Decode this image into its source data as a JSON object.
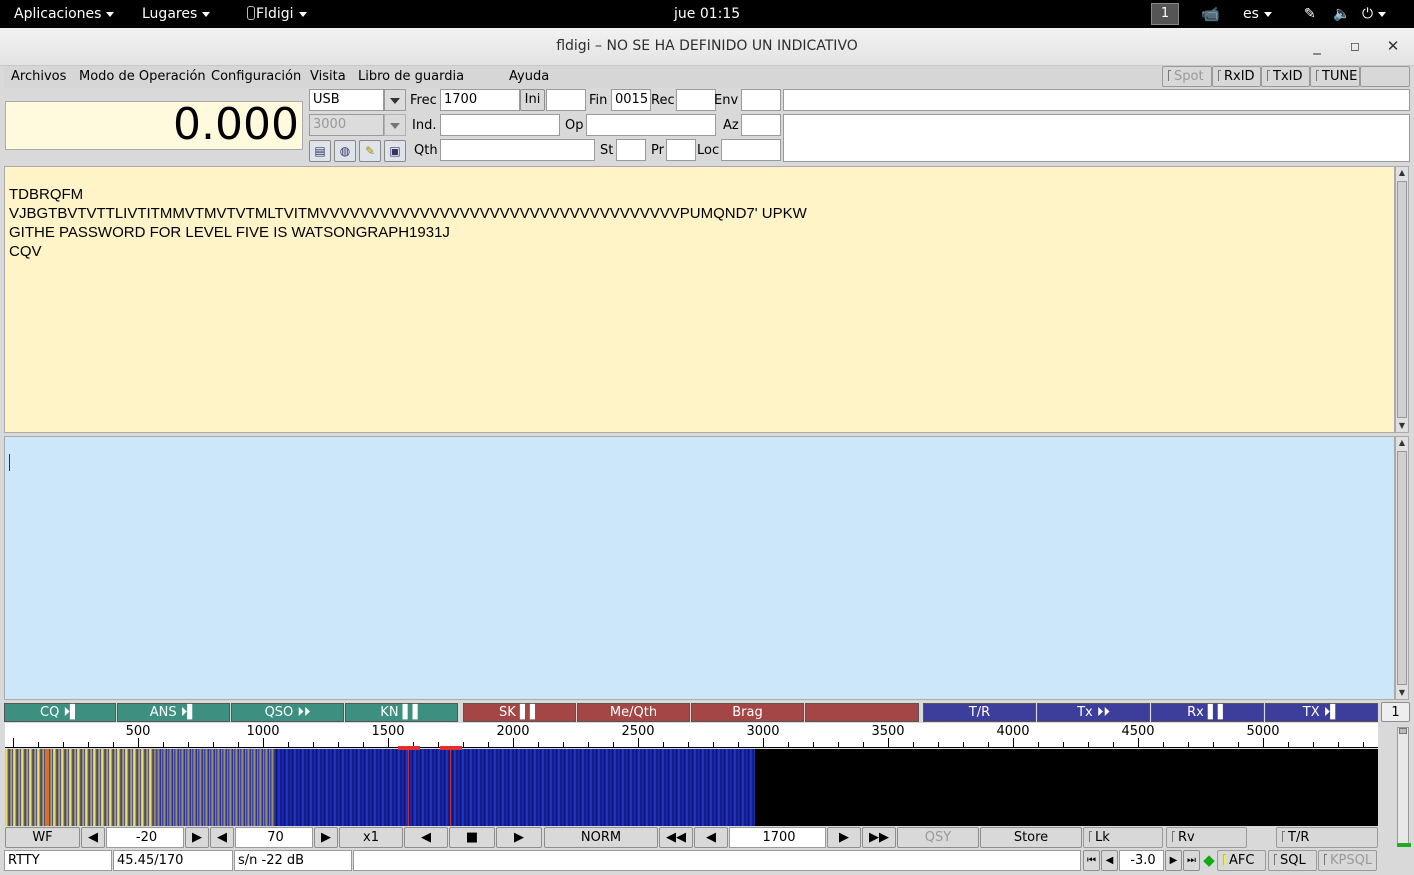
{
  "topbar": {
    "apps": "Aplicaciones",
    "places": "Lugares",
    "app_name": "Fldigi",
    "clock": "jue 01:15",
    "workspace": "1",
    "lang": "es"
  },
  "window": {
    "title": "fldigi – NO SE HA DEFINIDO UN INDICATIVO"
  },
  "menu": {
    "items": [
      "Archivos",
      "Modo de Operación",
      "Configuración",
      "Visita",
      "Libro de guardia",
      "Ayuda"
    ],
    "spot": "Spot",
    "rxid": "RxID",
    "txid": "TxID",
    "tune": "TUNE"
  },
  "log": {
    "frequency": "0.000",
    "mode": "USB",
    "bandwidth": "3000",
    "frec_label": "Frec",
    "frec_value": "1700",
    "ini_label": "Ini",
    "ini_value": "",
    "fin_label": "Fin",
    "fin_value": "0015",
    "rec_label": "Rec",
    "rec_value": "",
    "env_label": "Env",
    "env_value": "",
    "ind_label": "Ind.",
    "ind_value": "",
    "op_label": "Op",
    "op_value": "",
    "az_label": "Az",
    "az_value": "",
    "qth_label": "Qth",
    "qth_value": "",
    "st_label": "St",
    "st_value": "",
    "pr_label": "Pr",
    "pr_value": "",
    "loc_label": "Loc",
    "loc_value": ""
  },
  "rx_text": "TDBRQFM\nVJBGTBVTVTTLIVTITMMVTMVTVTMLTVITMVVVVVVVVVVVVVVVVVVVVVVVVVVVVVVVVVVVVPUMQND7' UPKW\nGITHE PASSWORD FOR LEVEL FIVE IS WATSONGRAPH1931J\nCQV",
  "macros": {
    "buttons": [
      {
        "label": "CQ ⏵▌",
        "color": "green"
      },
      {
        "label": "ANS ⏵▌",
        "color": "green"
      },
      {
        "label": "QSO ⏵⏵",
        "color": "green"
      },
      {
        "label": "KN ▌▌",
        "color": "green"
      },
      {
        "label": "SK ▌▌",
        "color": "red"
      },
      {
        "label": "Me/Qth",
        "color": "red"
      },
      {
        "label": "Brag",
        "color": "red"
      },
      {
        "label": "",
        "color": "red"
      },
      {
        "label": "T/R",
        "color": "blue"
      },
      {
        "label": "Tx ⏵⏵",
        "color": "blue"
      },
      {
        "label": "Rx ▌▌",
        "color": "blue"
      },
      {
        "label": "TX ⏵▌",
        "color": "blue"
      }
    ],
    "page": "1"
  },
  "waterfall": {
    "scale_labels": [
      "500",
      "1000",
      "1500",
      "2000",
      "2500",
      "3000",
      "3500",
      "4000",
      "4500",
      "5000"
    ]
  },
  "controls": {
    "wf": "WF",
    "ref_level": "-20",
    "range": "70",
    "zoom": "x1",
    "norm": "NORM",
    "carrier": "1700",
    "qsy": "QSY",
    "store": "Store",
    "lk": "Lk",
    "rv": "Rv",
    "tr": "T/R"
  },
  "status": {
    "mode": "RTTY",
    "baud": "45.45/170",
    "snr": "s/n -22 dB",
    "msg": "",
    "offset": "-3.0",
    "afc": "AFC",
    "sql": "SQL",
    "kpsql": "KPSQL"
  }
}
